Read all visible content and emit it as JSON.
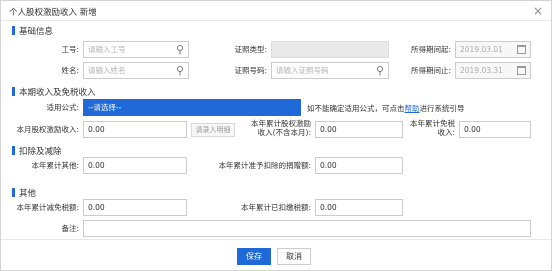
{
  "dialog": {
    "title": "个人股权激励收入 新增",
    "close": "×"
  },
  "sections": {
    "basic": "基础信息",
    "income": "本期收入及免税收入",
    "deduct": "扣除及减除",
    "other": "其他"
  },
  "basic": {
    "employee_no_label": "工号:",
    "employee_no_placeholder": "请输入工号",
    "name_label": "姓名:",
    "name_placeholder": "请输入姓名",
    "id_type_label": "证照类型:",
    "id_no_label": "证照号码:",
    "id_no_placeholder": "请输入证照号码",
    "period_start_label": "所得期间起:",
    "period_start": "2019.03.01",
    "period_end_label": "所得期间止:",
    "period_end": "2019.03.31"
  },
  "income": {
    "formula_label": "适用公式:",
    "formula_value": "--请选择--",
    "hint_text": "如不能确定适用公式，可点击",
    "hint_link": "帮助",
    "hint_tail": "进行系统引导",
    "monthly_label": "本月股权激励收入:",
    "monthly_value": "0.00",
    "import_btn": "请录入明细",
    "cum_income_label1": "本年累计股权激励",
    "cum_income_label2": "收入(不含本月):",
    "cum_income_value": "0.00",
    "cum_exempt_label1": "本年累计免税",
    "cum_exempt_label2": "收入:",
    "cum_exempt_value": "0.00"
  },
  "deduct": {
    "other_label": "本年累计其他:",
    "other_value": "0.00",
    "donation_label": "本年累计准予扣除的捐赠额:",
    "donation_value": "0.00"
  },
  "other": {
    "reduce_label": "本年累计减免税额:",
    "reduce_value": "0.00",
    "paid_label": "本年累计已扣缴税额:",
    "paid_value": "0.00",
    "remark_label": "备注:",
    "remark_value": ""
  },
  "footer": {
    "save": "保存",
    "cancel": "取消"
  },
  "colors": {
    "accent": "#1f6ad8",
    "disabled": "#e9e9e9"
  },
  "icons": {
    "search": "search-icon",
    "calendar": "calendar-icon",
    "close": "close-icon"
  }
}
